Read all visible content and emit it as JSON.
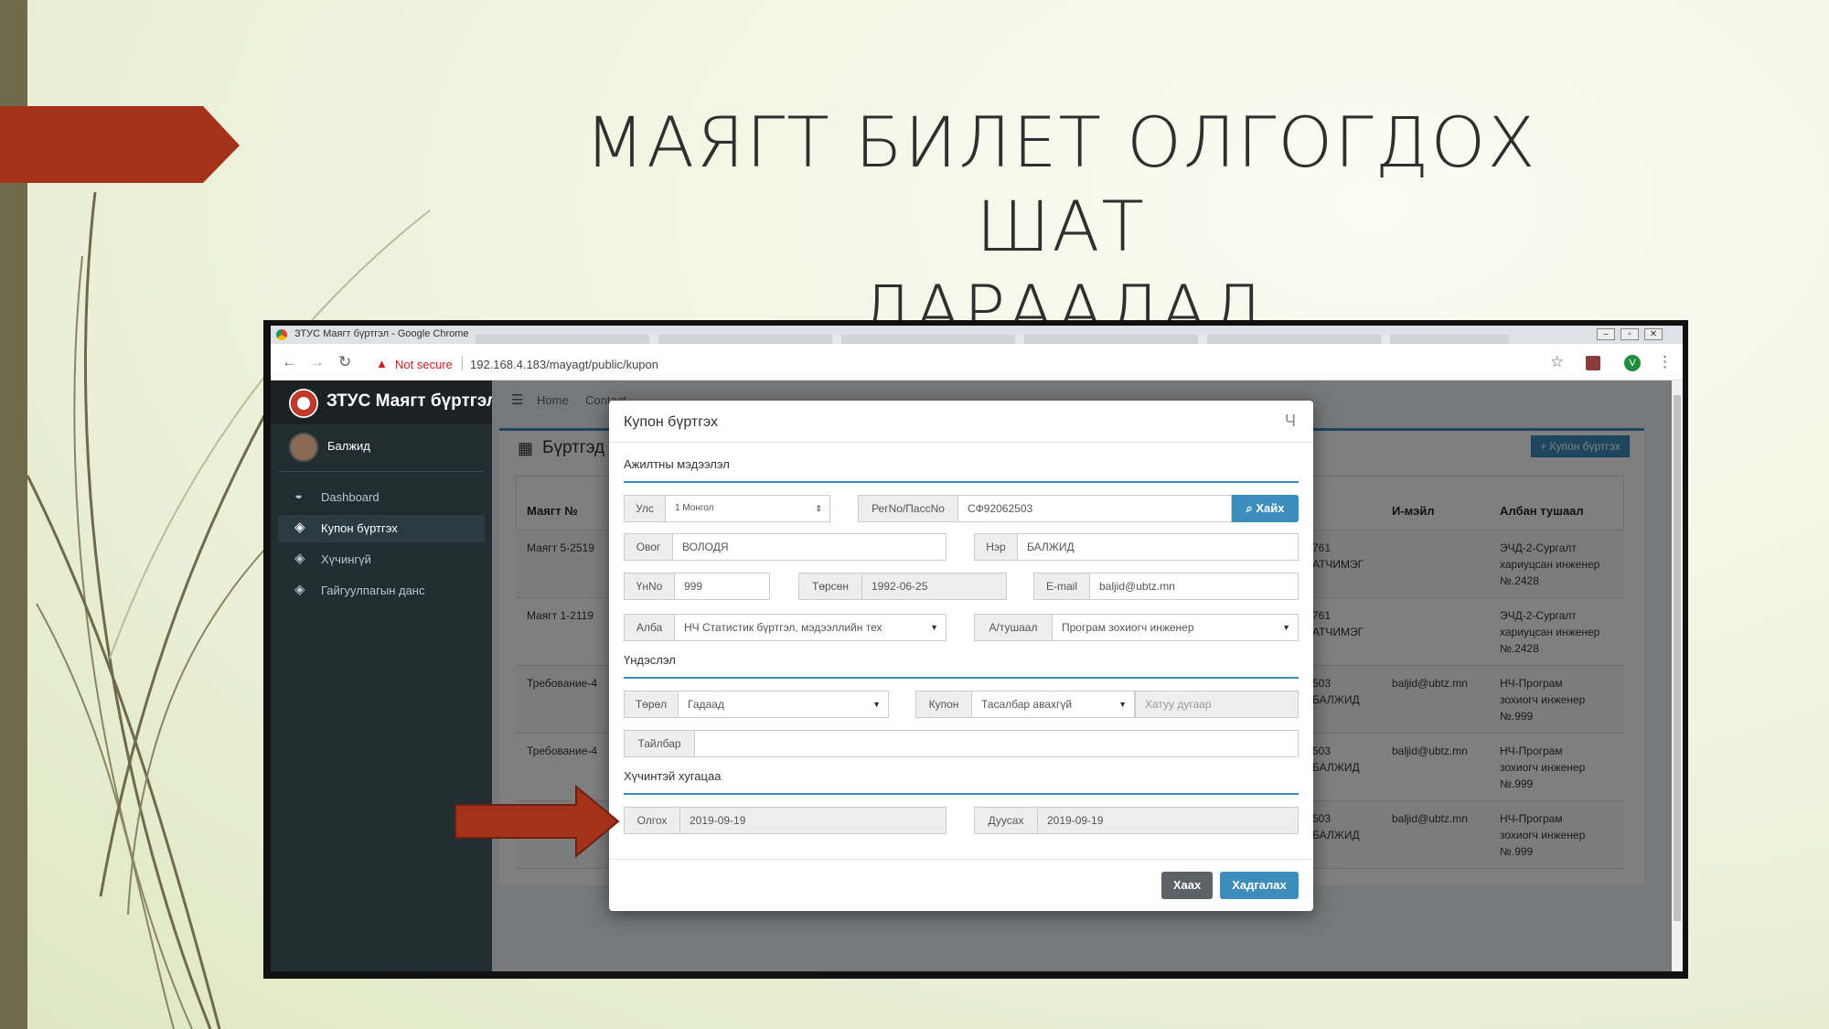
{
  "slide": {
    "title_line1": "МАЯГТ БИЛЕТ ОЛГОГДОХ ШАТ",
    "title_line2": "ДАРААЛАЛ"
  },
  "browser": {
    "window_title": "ЗТУС Маягт бүртгэл - Google Chrome",
    "security_label": "Not secure",
    "url": "192.168.4.183/mayagt/public/kupon",
    "profile_initial": "V",
    "icons": [
      "chrome-icon",
      "back-icon",
      "forward-icon",
      "reload-icon",
      "warning-icon",
      "star-icon",
      "extension-icon",
      "profile-icon",
      "menu-icon"
    ]
  },
  "app": {
    "brand": "ЗТУС Маягт бүртгэл",
    "user_name": "Балжид",
    "sidebar": [
      {
        "label": "Dashboard",
        "icon": "dashboard-icon",
        "active": false
      },
      {
        "label": "Купон бүртгэх",
        "icon": "ticket-icon",
        "active": true
      },
      {
        "label": "Хүчингүй",
        "icon": "ticket-icon",
        "active": false
      },
      {
        "label": "Гайгуулпагын данс",
        "icon": "ticket-icon",
        "active": false
      }
    ],
    "topnav": {
      "home": "Home",
      "contact": "Contact"
    },
    "panel_title": "Бүртгэд",
    "add_button": "Купон бүртгэх",
    "table": {
      "headers": {
        "form_no": "Маягт №",
        "email": "И-мэйл",
        "position": "Албан тушаал"
      },
      "rows": [
        {
          "form_no": "Маягт 5-2519",
          "mid_l1": "761",
          "mid_l2": "АТЧИМЭГ",
          "email": "",
          "pos_l1": "ЭЧД-2-Сургалт",
          "pos_l2": "хариуцсан инженер",
          "pos_l3": "№.2428"
        },
        {
          "form_no": "Маягт 1-2119",
          "mid_l1": "761",
          "mid_l2": "АТЧИМЭГ",
          "email": "",
          "pos_l1": "ЭЧД-2-Сургалт",
          "pos_l2": "хариуцсан инженер",
          "pos_l3": "№.2428"
        },
        {
          "form_no": "Требование-4",
          "mid_l1": "503",
          "mid_l2": "БАЛЖИД",
          "email": "baljid@ubtz.mn",
          "pos_l1": "НЧ-Програм",
          "pos_l2": "зохиогч инженер",
          "pos_l3": "№.999"
        },
        {
          "form_no": "Требование-4",
          "mid_l1": "503",
          "mid_l2": "БАЛЖИД",
          "email": "baljid@ubtz.mn",
          "pos_l1": "НЧ-Програм",
          "pos_l2": "зохиогч инженер",
          "pos_l3": "№.999"
        },
        {
          "form_no": "",
          "mid_l1": "503",
          "mid_l2": "БАЛЖИД",
          "email": "baljid@ubtz.mn",
          "pos_l1": "НЧ-Програм",
          "pos_l2": "зохиогч инженер",
          "pos_l3": "№.999"
        }
      ]
    }
  },
  "modal": {
    "title": "Купон бүртгэх",
    "close_glyph": "Ч",
    "section_employee": "Ажилтны мэдээлэл",
    "country_label": "Улс",
    "country_value": "1 Монгол",
    "reg_label": "РегNo/ПассNo",
    "reg_value": "СФ92062503",
    "search_button": "Хайх",
    "lastname_label": "Овог",
    "lastname_value": "ВОЛОДЯ",
    "firstname_label": "Нэр",
    "firstname_value": "БАЛЖИД",
    "id_label": "ҮнNo",
    "id_value": "999",
    "birth_label": "Төрсөн",
    "birth_value": "1992-06-25",
    "email_label": "E-mail",
    "email_value": "baljid@ubtz.mn",
    "dept_label": "Алба",
    "dept_value": "НЧ Статистик бүртгэл, мэдээллийн тех",
    "position_label": "А/тушаал",
    "position_value": "Програм зохиогч инженер",
    "section_basis": "Үндэслэл",
    "type_label": "Төрөл",
    "type_value": "Гадаад",
    "coupon_label": "Купон",
    "coupon_value": "Тасалбар авахгүй",
    "hard_number_placeholder": "Хатуу дугаар",
    "note_label": "Тайлбар",
    "note_value": "",
    "section_validity": "Хүчинтэй хугацаа",
    "start_label": "Олгох",
    "start_value": "2019-09-19",
    "end_label": "Дуусах",
    "end_value": "2019-09-19",
    "close_button": "Хаах",
    "save_button": "Хадгалах"
  },
  "colors": {
    "accent": "#3c8dbc",
    "arrow": "#a3321a",
    "slide_bar": "#6f6a4c",
    "sidebar": "#222d32"
  }
}
